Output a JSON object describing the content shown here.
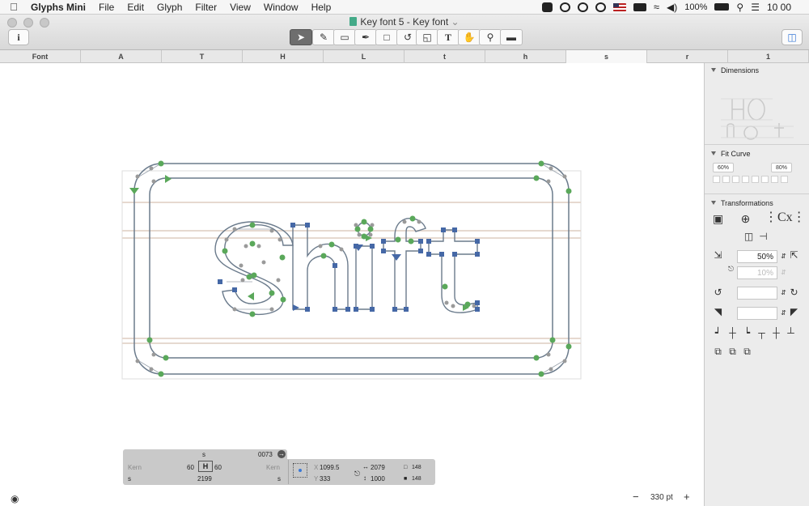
{
  "menubar": {
    "app_name": "Glyphs Mini",
    "menus": [
      "File",
      "Edit",
      "Glyph",
      "Filter",
      "View",
      "Window",
      "Help"
    ],
    "battery": "100%",
    "clock": "10 00"
  },
  "window": {
    "title": "Key font 5 - Key font",
    "title_chevron": "⌄"
  },
  "tabs": [
    "Font",
    "A",
    "T",
    "H",
    "L",
    "t",
    "h",
    "s",
    "r",
    "1"
  ],
  "selected_tab_index": 7,
  "panel": {
    "dimensions_title": "Dimensions",
    "fit_curve_title": "Fit Curve",
    "fit_left": "60%",
    "fit_right": "80%",
    "transformations_title": "Transformations",
    "scale_value": "50%",
    "scale_secondary": "10%"
  },
  "info_box": {
    "glyph_name": "s",
    "unicode": "0073",
    "kern_left_label": "Kern",
    "kern_right_label": "Kern",
    "lsb": "60",
    "rsb": "60",
    "left_group": "s",
    "right_group": "s",
    "width": "2199",
    "x_label": "X",
    "y_label": "Y",
    "x_value": "1099.5",
    "y_value": "333",
    "w_value": "2079",
    "h_value": "1000",
    "count_a": "148",
    "count_b": "148"
  },
  "zoom": {
    "minus": "−",
    "value": "330 pt",
    "plus": "+"
  },
  "colors": {
    "node_green": "#5aa85a",
    "node_blue": "#4568a6",
    "outline": "#6b7b8c",
    "metric_line": "#e9ddd6"
  }
}
